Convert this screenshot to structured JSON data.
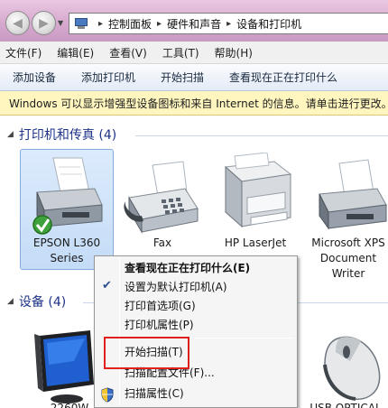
{
  "address_bar": {
    "breadcrumbs": [
      "控制面板",
      "硬件和声音",
      "设备和打印机"
    ]
  },
  "menu": {
    "items": [
      "文件(F)",
      "编辑(E)",
      "查看(V)",
      "工具(T)",
      "帮助(H)"
    ]
  },
  "toolbar": {
    "items": [
      "添加设备",
      "添加打印机",
      "开始扫描",
      "查看现在正在打印什么"
    ]
  },
  "infobar": {
    "text": "Windows 可以显示增强型设备图标和来自 Internet 的信息。请单击进行更改。"
  },
  "printers_group": {
    "title": "打印机和传真 (4)",
    "devices": [
      {
        "line1": "EPSON L360",
        "line2": "Series",
        "line3": ""
      },
      {
        "line1": "Fax",
        "line2": "",
        "line3": ""
      },
      {
        "line1": "HP LaserJet",
        "line2": "",
        "line3": ""
      },
      {
        "line1": "Microsoft XPS",
        "line2": "Document",
        "line3": "Writer"
      }
    ]
  },
  "devices_group": {
    "title": "设备 (4)",
    "partial_labels": [
      "2260W",
      "USB OPTICAL"
    ]
  },
  "context_menu": {
    "items": [
      "查看现在正在打印什么(E)",
      "设置为默认打印机(A)",
      "打印首选项(G)",
      "打印机属性(P)",
      "开始扫描(T)",
      "扫描配置文件(F)...",
      "扫描属性(C)"
    ]
  },
  "colors": {
    "accent": "#1e3287",
    "highlight": "#e0201c"
  }
}
